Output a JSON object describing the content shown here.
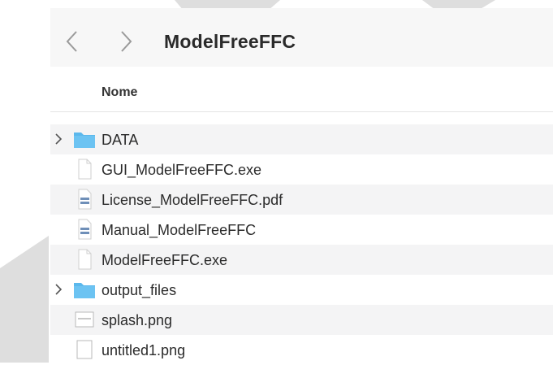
{
  "toolbar": {
    "title": "ModelFreeFFC",
    "back_icon": "chevron-left-icon",
    "forward_icon": "chevron-right-icon"
  },
  "columns": {
    "name": "Nome"
  },
  "files": [
    {
      "name": "DATA",
      "kind": "folder",
      "expandable": true,
      "icon": "folder-icon"
    },
    {
      "name": "GUI_ModelFreeFFC.exe",
      "kind": "file",
      "expandable": false,
      "icon": "document-icon"
    },
    {
      "name": "License_ModelFreeFFC.pdf",
      "kind": "pdf",
      "expandable": false,
      "icon": "pdf-icon"
    },
    {
      "name": "Manual_ModelFreeFFC",
      "kind": "pdf",
      "expandable": false,
      "icon": "pdf-icon"
    },
    {
      "name": "ModelFreeFFC.exe",
      "kind": "file",
      "expandable": false,
      "icon": "document-icon"
    },
    {
      "name": "output_files",
      "kind": "folder",
      "expandable": true,
      "icon": "folder-icon"
    },
    {
      "name": "splash.png",
      "kind": "image",
      "expandable": false,
      "icon": "image-icon"
    },
    {
      "name": "untitled1.png",
      "kind": "image",
      "expandable": false,
      "icon": "image-icon"
    }
  ],
  "colors": {
    "folder_blue": "#5bb8ec",
    "toolbar_bg": "#f7f7f7",
    "row_alt_bg": "#f4f4f5",
    "overlay_gray": "#dedede"
  }
}
